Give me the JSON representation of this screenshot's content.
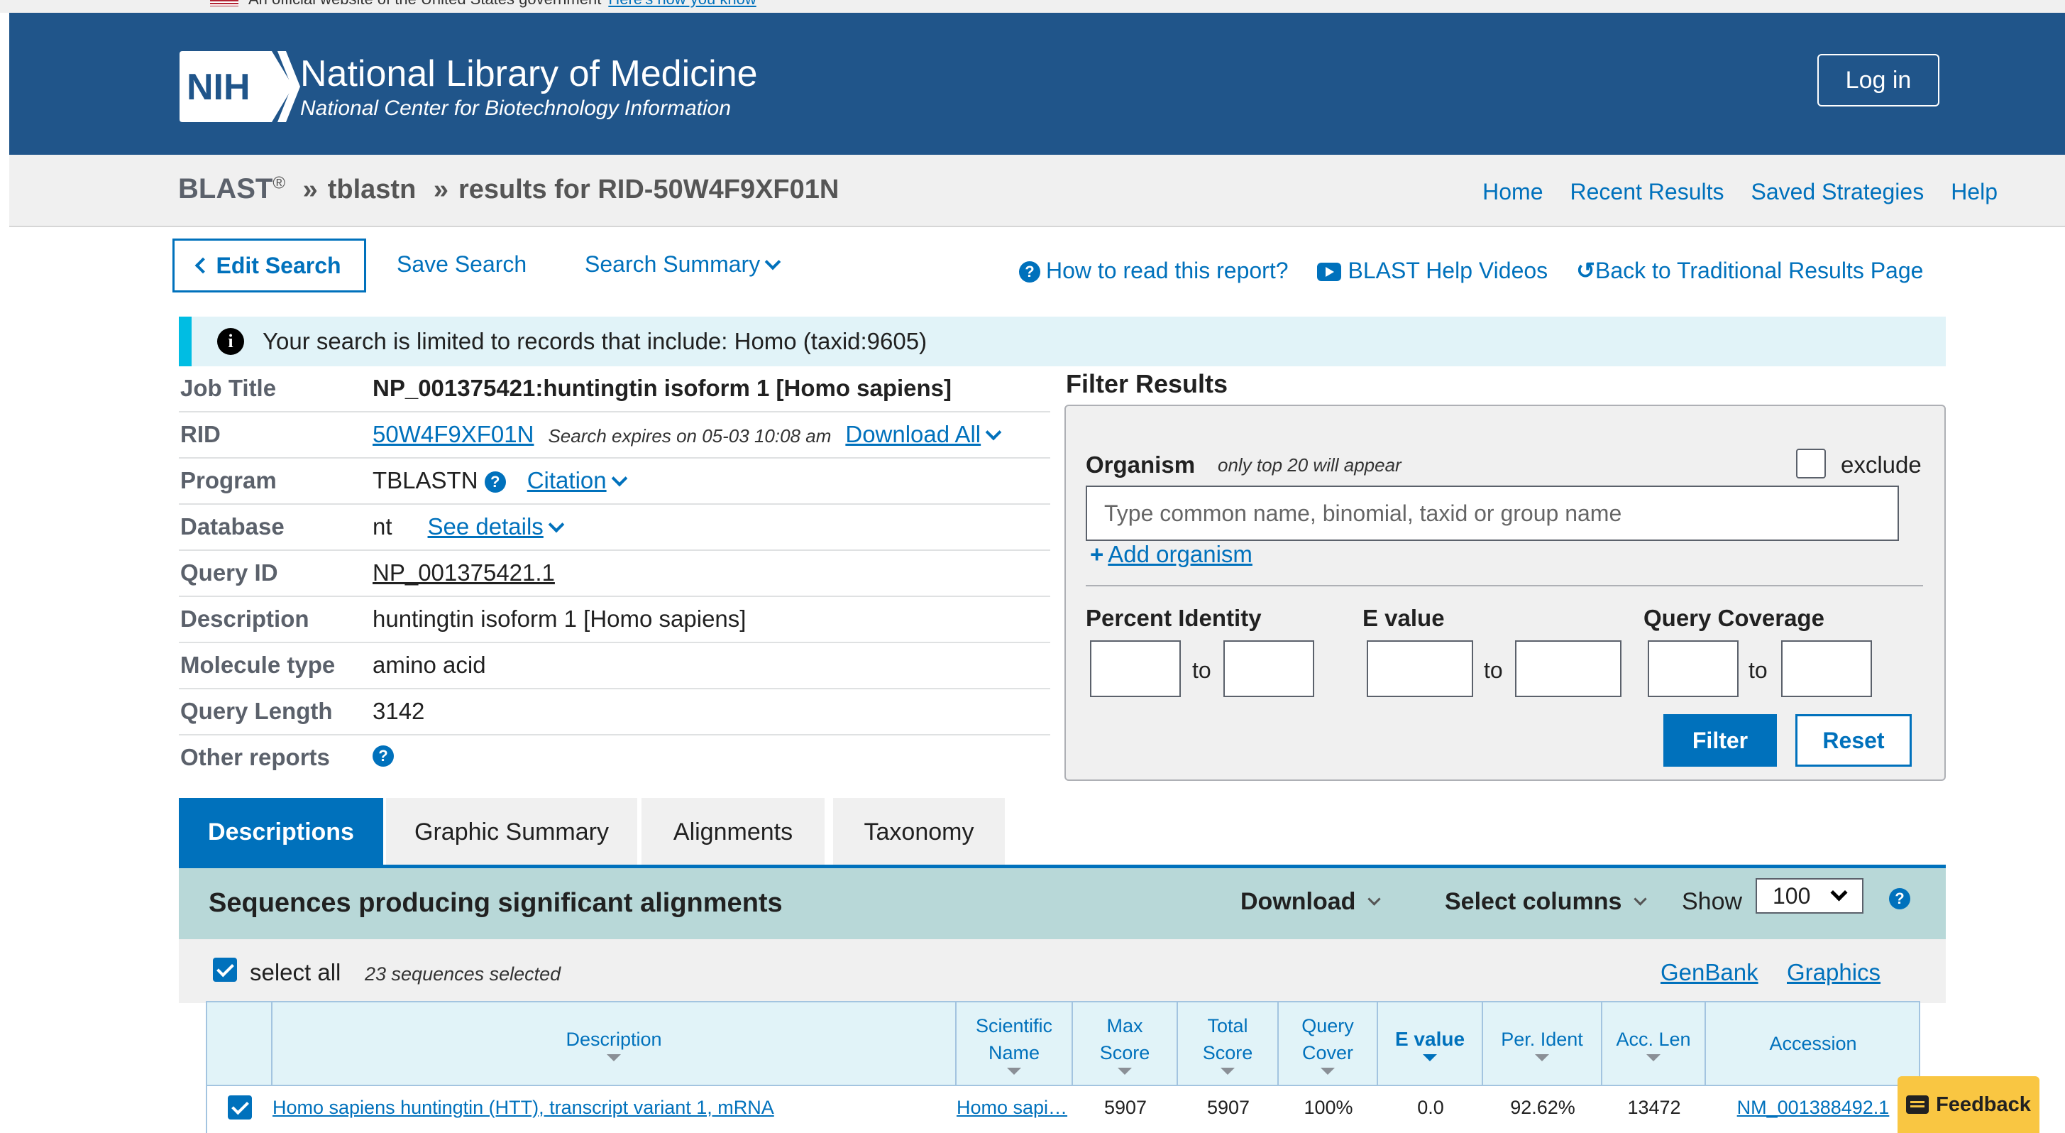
{
  "gov_banner": {
    "text": "An official website of the United States government",
    "link": "Here's how you know"
  },
  "header": {
    "logo_text": "NIH",
    "title": "National Library of Medicine",
    "subtitle": "National Center for Biotechnology Information",
    "login_label": "Log in",
    "brand_color": "#20558a"
  },
  "breadcrumb": {
    "root": "BLAST",
    "reg": "®",
    "sep": "»",
    "program": "tblastn",
    "results": "results for RID-50W4F9XF01N"
  },
  "top_nav": [
    "Home",
    "Recent Results",
    "Saved Strategies",
    "Help"
  ],
  "toolbar": {
    "edit_search": "Edit Search",
    "save_search": "Save Search",
    "search_summary": "Search Summary",
    "how_to_read": "How to read this report?",
    "help_videos": "BLAST Help Videos",
    "back_traditional": "Back to Traditional Results Page"
  },
  "notice": {
    "icon": "info-icon",
    "text": "Your search is limited to records that include: Homo (taxid:9605)"
  },
  "job": {
    "job_title_label": "Job Title",
    "job_title": "NP_001375421:huntingtin isoform 1 [Homo sapiens]",
    "rid_label": "RID",
    "rid": "50W4F9XF01N",
    "expires": "Search expires on 05-03 10:08 am",
    "download_all": "Download All",
    "program_label": "Program",
    "program": "TBLASTN",
    "citation": "Citation",
    "database_label": "Database",
    "database": "nt",
    "see_details": "See details",
    "query_id_label": "Query ID",
    "query_id": "NP_001375421.1",
    "description_label": "Description",
    "description": "huntingtin isoform 1 [Homo sapiens]",
    "molecule_label": "Molecule type",
    "molecule": "amino acid",
    "length_label": "Query Length",
    "length": "3142",
    "other_label": "Other reports"
  },
  "filter": {
    "title": "Filter Results",
    "organism_label": "Organism",
    "organism_hint": "only top 20 will appear",
    "exclude_label": "exclude",
    "organism_placeholder": "Type common  name, binomial, taxid or group  name",
    "add_organism": "Add organism",
    "percent_identity": "Percent Identity",
    "e_value": "E value",
    "query_coverage": "Query Coverage",
    "to": "to",
    "filter_btn": "Filter",
    "reset_btn": "Reset"
  },
  "tabs": [
    "Descriptions",
    "Graphic Summary",
    "Alignments",
    "Taxonomy"
  ],
  "descriptions": {
    "title": "Sequences producing significant alignments",
    "download": "Download",
    "select_columns": "Select columns",
    "show": "Show",
    "show_value": "100",
    "select_all": "select all",
    "selected_count": "23 sequences selected",
    "genbank": "GenBank",
    "graphics": "Graphics"
  },
  "table": {
    "headers": {
      "description": "Description",
      "scientific_1": "Scientific",
      "scientific_2": "Name",
      "max_1": "Max",
      "max_2": "Score",
      "total_1": "Total",
      "total_2": "Score",
      "query_1": "Query",
      "query_2": "Cover",
      "evalue": "E value",
      "per_ident": "Per. Ident",
      "acc_len": "Acc. Len",
      "accession": "Accession"
    },
    "rows": [
      {
        "description": "Homo sapiens huntingtin (HTT), transcript variant 1, mRNA",
        "scientific_name": "Homo sapi…",
        "max_score": "5907",
        "total_score": "5907",
        "query_cover": "100%",
        "e_value": "0.0",
        "per_ident": "92.62%",
        "acc_len": "13472",
        "accession": "NM_001388492.1"
      }
    ]
  },
  "feedback": "Feedback"
}
